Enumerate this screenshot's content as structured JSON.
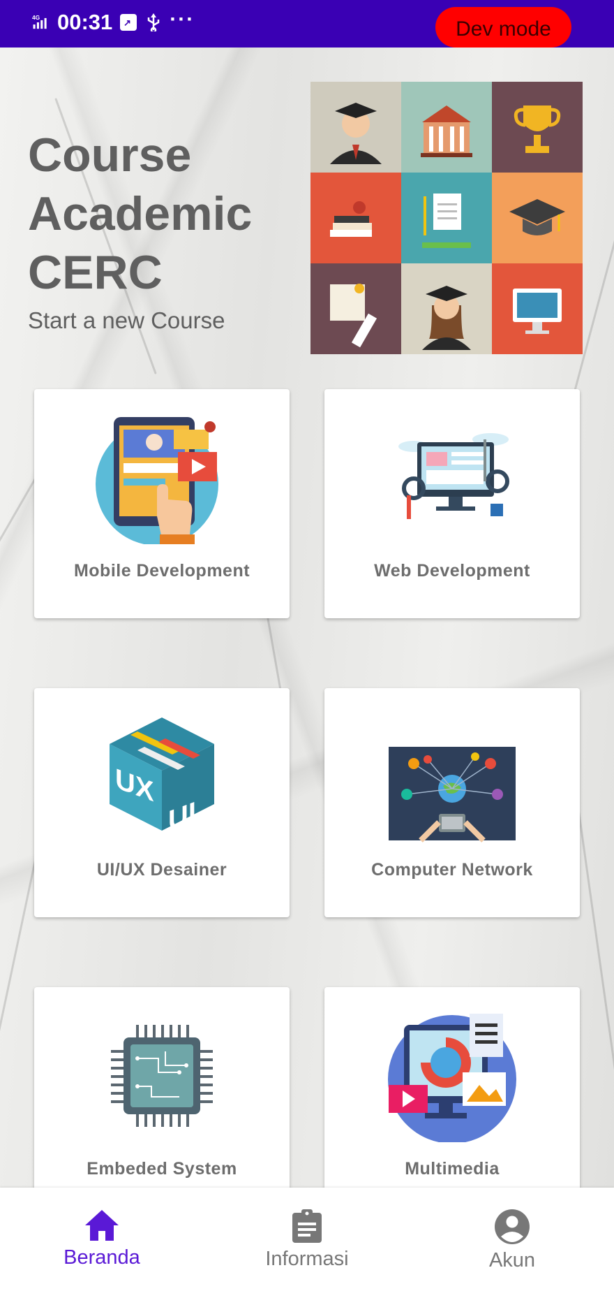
{
  "status_bar": {
    "network": "4G",
    "time": "00:31",
    "more": "···",
    "dev_mode_label": "Dev mode"
  },
  "hero": {
    "title_lines": [
      "Course",
      "Academic",
      "CERC"
    ],
    "subtitle": "Start a new Course"
  },
  "courses": [
    {
      "label": "Mobile Development"
    },
    {
      "label": "Web Development"
    },
    {
      "label": "UI/UX Desainer"
    },
    {
      "label": "Computer Network"
    },
    {
      "label": "Embeded System"
    },
    {
      "label": "Multimedia"
    }
  ],
  "bottom_nav": [
    {
      "label": "Beranda",
      "icon": "home-icon",
      "active": true
    },
    {
      "label": "Informasi",
      "icon": "clipboard-icon",
      "active": false
    },
    {
      "label": "Akun",
      "icon": "account-circle-icon",
      "active": false
    }
  ],
  "colors": {
    "status_bar": "#3a00b4",
    "dev_mode": "#ff0000",
    "active_nav": "#5a19d6",
    "inactive_nav": "#757575"
  }
}
